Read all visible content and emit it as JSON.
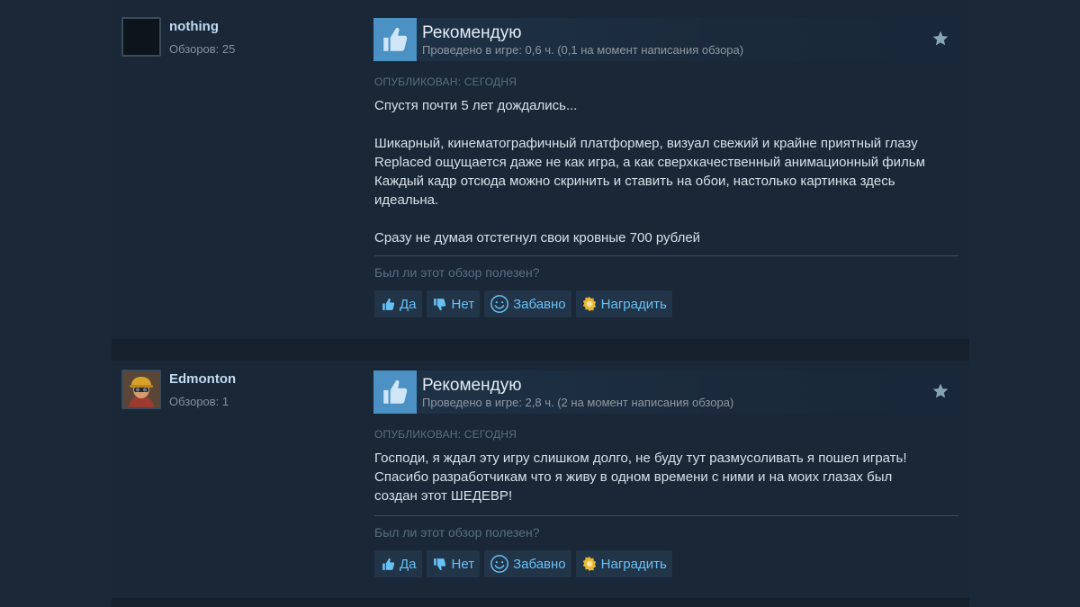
{
  "reviews": [
    {
      "username": "nothing",
      "review_count": "Обзоров: 25",
      "verdict": "Рекомендую",
      "hours": "Проведено в игре: 0,6 ч. (0,1 на момент написания обзора)",
      "posted": "ОПУБЛИКОВАН: СЕГОДНЯ",
      "paragraphs": [
        [
          "Спустя почти 5 лет дождались..."
        ],
        [
          "Шикарный, кинематографичный платформер, визуал свежий и крайне приятный глазу",
          "Replaced ощущается даже не как игра, а как сверхкачественный анимационный фильм",
          "Каждый кадр отсюда можно скринить и ставить на обои, настолько картинка здесь",
          "идеальна."
        ],
        [
          "Сразу не думая отстегнул свои кровные 700 рублей"
        ]
      ],
      "helpful_question": "Был ли этот обзор полезен?",
      "buttons": {
        "yes": "Да",
        "no": "Нет",
        "funny": "Забавно",
        "award": "Наградить"
      }
    },
    {
      "username": "Edmonton",
      "review_count": "Обзоров: 1",
      "verdict": "Рекомендую",
      "hours": "Проведено в игре: 2,8 ч. (2 на момент написания обзора)",
      "posted": "ОПУБЛИКОВАН: СЕГОДНЯ",
      "paragraphs": [
        [
          "Господи, я ждал эту игру слишком долго, не буду тут размусоливать я пошел играть!",
          "Спасибо разработчикам что я живу в одном времени с ними и на моих глазах был",
          "создан этот ШЕДЕВР!"
        ]
      ],
      "helpful_question": "Был ли этот обзор полезен?",
      "buttons": {
        "yes": "Да",
        "no": "Нет",
        "funny": "Забавно",
        "award": "Наградить"
      }
    }
  ],
  "icons": {
    "thumb_up": "thumbs-up-icon",
    "thumb_down": "thumbs-down-icon",
    "funny": "smiley-icon",
    "award": "award-icon",
    "star": "star-icon"
  },
  "colors": {
    "page_bg": "#1b2838",
    "review_bg": "#1a2737",
    "thumb_box": "#4c91c4",
    "link_blue": "#67c1f5",
    "username": "#c1dbf4"
  }
}
